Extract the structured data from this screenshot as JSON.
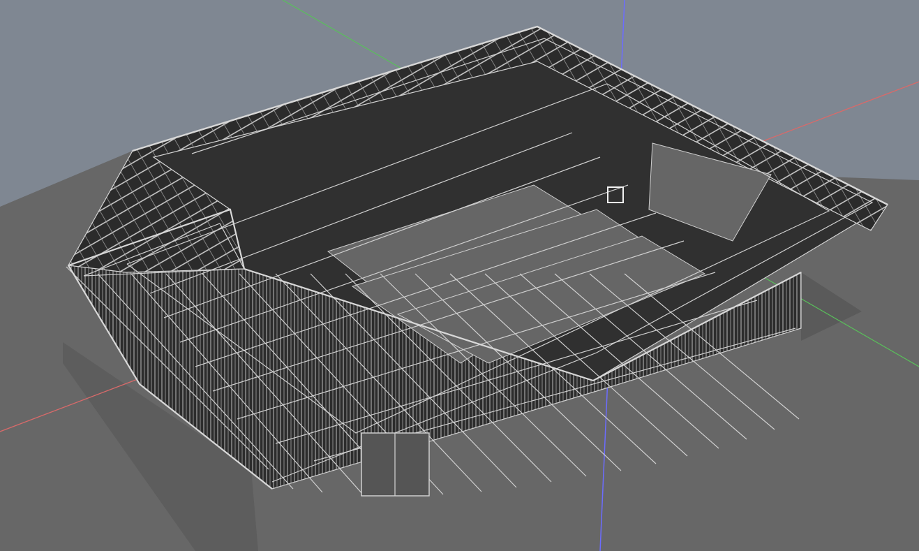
{
  "viewport": {
    "background_sky": "#7f8792",
    "background_ground": "#676767",
    "axes": {
      "red": "#d86a6a",
      "green": "#59c05a",
      "blue": "#6c6cff"
    },
    "model": {
      "frame_color": "#3a3a3a",
      "edge_color": "#d0d0d0",
      "shadow_color": "#5a5a5a"
    },
    "cursor_icon": "cursor-box-icon"
  }
}
